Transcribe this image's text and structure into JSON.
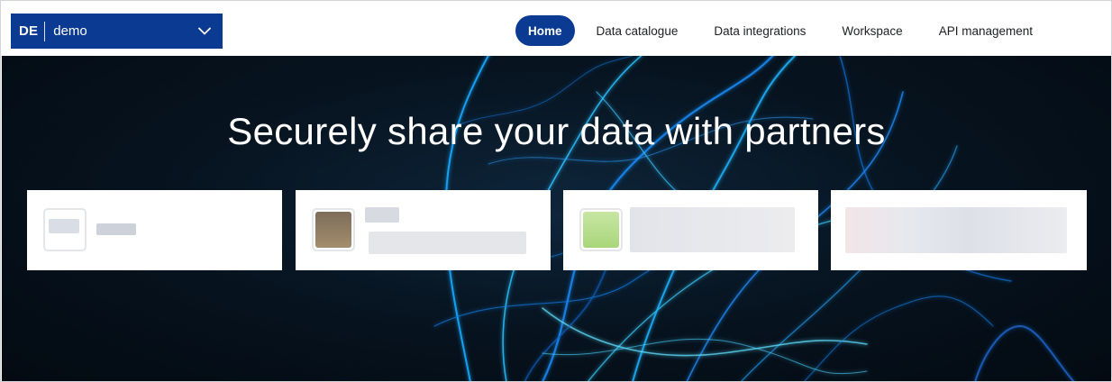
{
  "header": {
    "org_selector": {
      "code": "DE",
      "name": "demo",
      "icon": "chevron-down-icon"
    },
    "nav": [
      {
        "label": "Home",
        "active": true
      },
      {
        "label": "Data catalogue",
        "active": false
      },
      {
        "label": "Data integrations",
        "active": false
      },
      {
        "label": "Workspace",
        "active": false
      },
      {
        "label": "API management",
        "active": false
      }
    ]
  },
  "hero": {
    "title": "Securely share your data with partners"
  },
  "colors": {
    "brand": "#0b3a93",
    "hero_background": "#071420",
    "light_streak": "#1aa8ff"
  }
}
